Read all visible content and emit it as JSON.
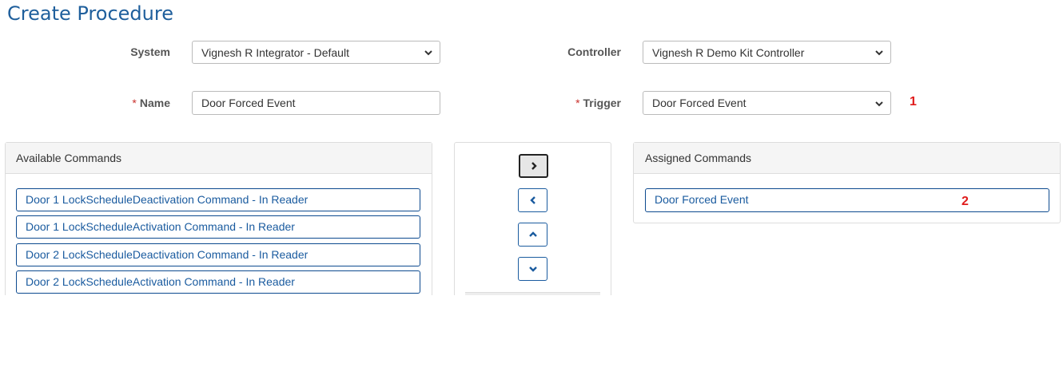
{
  "page": {
    "title": "Create Procedure"
  },
  "form": {
    "system": {
      "label": "System",
      "value": "Vignesh R Integrator - Default"
    },
    "controller": {
      "label": "Controller",
      "value": "Vignesh R Demo Kit Controller"
    },
    "name": {
      "label": "Name",
      "required_marker": "*",
      "value": "Door Forced Event"
    },
    "trigger": {
      "label": "Trigger",
      "required_marker": "*",
      "value": "Door Forced Event"
    }
  },
  "annotations": {
    "trigger_marker": "1",
    "assigned_marker": "2"
  },
  "available_commands": {
    "title": "Available Commands",
    "items": [
      "Door 1 LockScheduleDeactivation Command - In Reader",
      "Door 1 LockScheduleActivation Command - In Reader",
      "Door 2 LockScheduleDeactivation Command - In Reader",
      "Door 2 LockScheduleActivation Command - In Reader"
    ]
  },
  "assigned_commands": {
    "title": "Assigned Commands",
    "items": [
      "Door Forced Event"
    ]
  },
  "controls": {
    "icons": [
      "chevron-right-icon",
      "chevron-left-icon",
      "chevron-up-icon",
      "chevron-down-icon"
    ]
  },
  "colors": {
    "accent": "#1a5b9f",
    "title": "#1f5f9c",
    "annotation": "#e01b1b",
    "required": "#c9302c"
  }
}
